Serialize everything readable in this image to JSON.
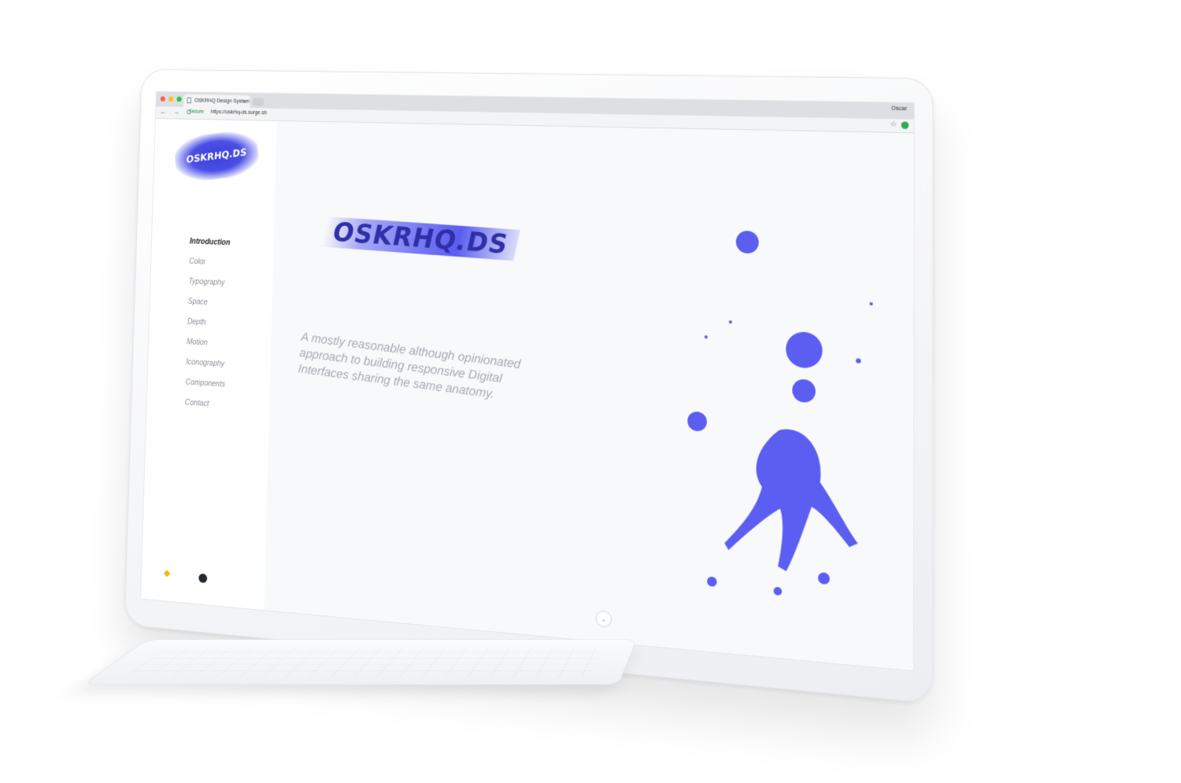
{
  "browser": {
    "tab_title": "OSKRHQ Design System",
    "tab_close": "×",
    "user_name": "Oscar",
    "nav_buttons": "← → C",
    "secure_label": "Secure",
    "url": "https://oskrhq-ds.surge.sh",
    "bookmark_icon": "☆",
    "traffic_lights": [
      "#ff5f57",
      "#febc2e",
      "#28c840"
    ]
  },
  "sidebar": {
    "logo_text": "OSKRHQ.DS",
    "items": [
      {
        "label": "Introduction",
        "active": true
      },
      {
        "label": "Color",
        "active": false
      },
      {
        "label": "Typography",
        "active": false
      },
      {
        "label": "Space",
        "active": false
      },
      {
        "label": "Depth",
        "active": false
      },
      {
        "label": "Motion",
        "active": false
      },
      {
        "label": "Iconography",
        "active": false
      },
      {
        "label": "Components",
        "active": false
      },
      {
        "label": "Contact",
        "active": false
      }
    ],
    "footer_icons": [
      "sketch-icon",
      "github-icon"
    ]
  },
  "main": {
    "hero_title": "OSKRHQ.DS",
    "tagline": "A mostly reasonable although opinionated approach to building responsive Digital Interfaces sharing the same anatomy.",
    "scroll_icon": "⌄"
  },
  "colors": {
    "accent": "#5b5ef0",
    "accent_dark": "#2f2fa8",
    "sidebar_bg": "#ffffff",
    "content_bg": "#f8f9fb"
  }
}
